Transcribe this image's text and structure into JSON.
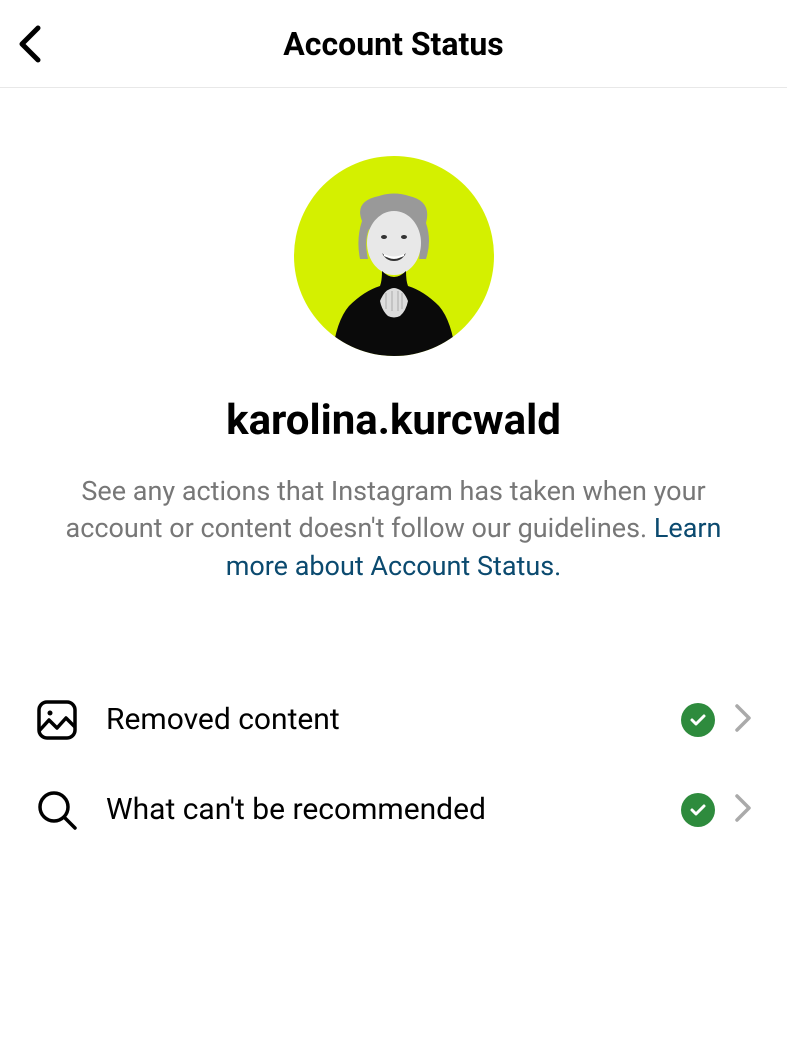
{
  "header": {
    "title": "Account Status"
  },
  "profile": {
    "username": "karolina.kurcwald",
    "description": "See any actions that Instagram has taken when your account or content doesn't follow our guidelines. ",
    "learn_more": "Learn more about Account Status."
  },
  "items": [
    {
      "label": "Removed content",
      "icon": "image-icon"
    },
    {
      "label": "What can't be recommended",
      "icon": "search-icon"
    }
  ]
}
